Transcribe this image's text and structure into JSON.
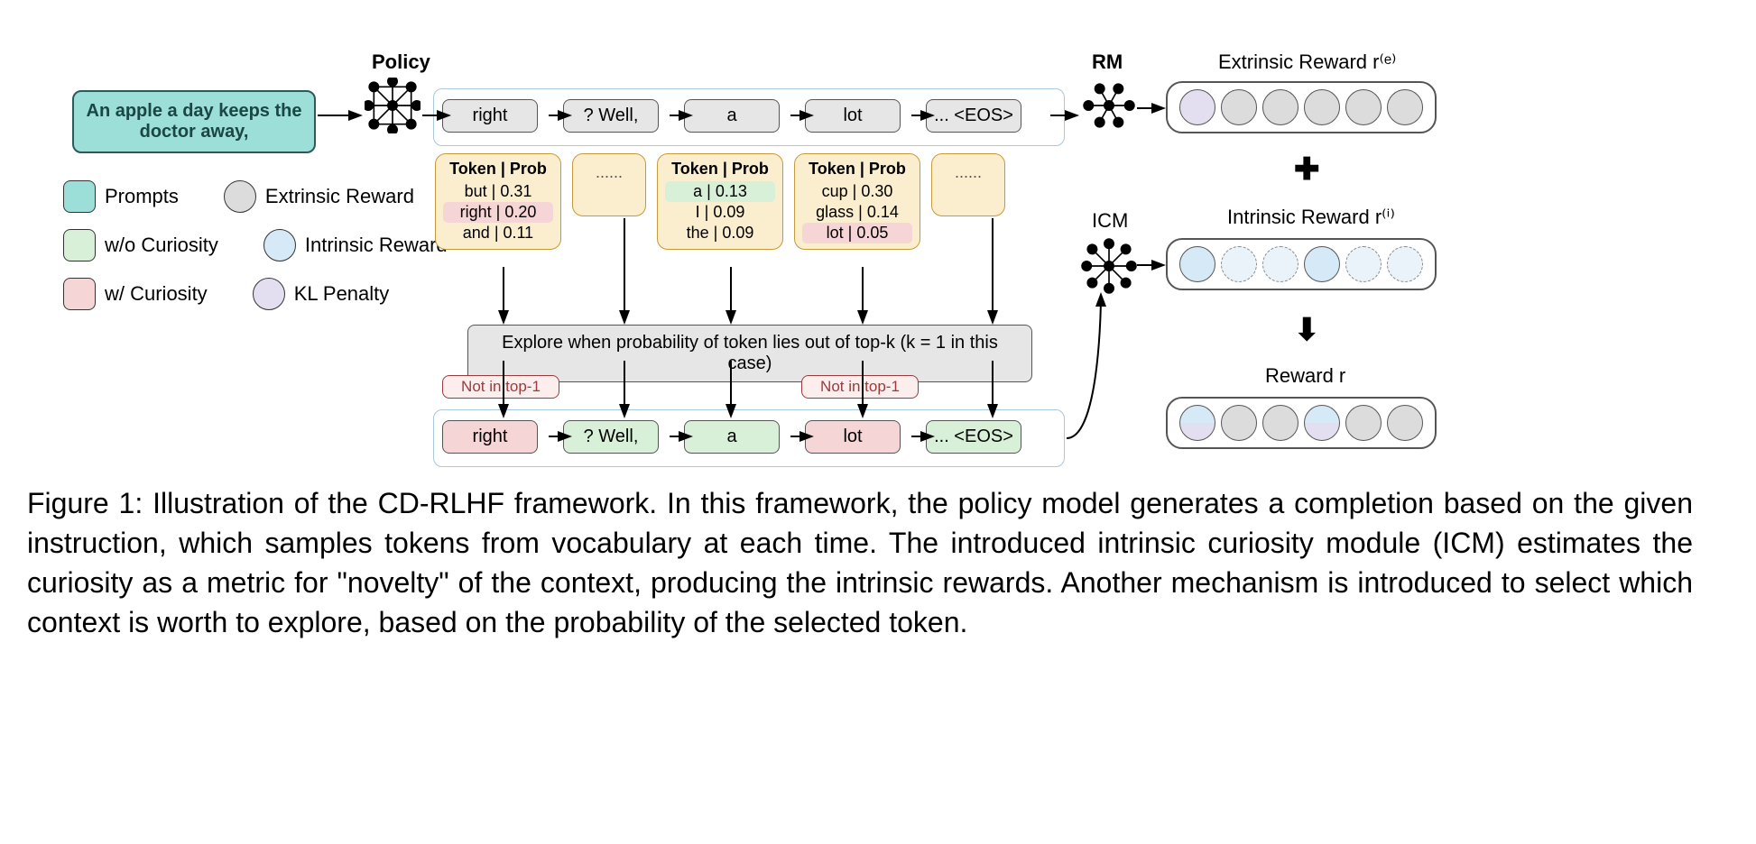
{
  "legend": {
    "prompts": "Prompts",
    "extrinsic_reward": "Extrinsic Reward",
    "wo_curiosity": "w/o Curiosity",
    "intrinsic_reward": "Intrinsic Reward",
    "w_curiosity": "w/ Curiosity",
    "kl_penalty": "KL Penalty"
  },
  "prompt": "An apple a day keeps the doctor away,",
  "labels": {
    "policy": "Policy",
    "rm": "RM",
    "icm": "ICM",
    "extrinsic_title": "Extrinsic Reward r⁽ᵉ⁾",
    "intrinsic_title": "Intrinsic Reward r⁽ⁱ⁾",
    "reward_title": "Reward r"
  },
  "tokens_top": [
    "right",
    "? Well,",
    "a",
    "lot",
    "... <EOS>"
  ],
  "prob_header": "Token | Prob",
  "prob1": [
    {
      "t": "but | 0.31",
      "cls": ""
    },
    {
      "t": "right | 0.20",
      "cls": "pink"
    },
    {
      "t": "and | 0.11",
      "cls": ""
    }
  ],
  "prob2": [
    {
      "t": "a | 0.13",
      "cls": "green"
    },
    {
      "t": "I | 0.09",
      "cls": ""
    },
    {
      "t": "the | 0.09",
      "cls": ""
    }
  ],
  "prob3": [
    {
      "t": "cup | 0.30",
      "cls": ""
    },
    {
      "t": "glass | 0.14",
      "cls": ""
    },
    {
      "t": "lot | 0.05",
      "cls": "pink"
    }
  ],
  "prob_ellipsis": "......",
  "explore": "Explore when probability of token lies out of top-k (k = 1 in this case)",
  "not_in": "Not in top-1",
  "tokens_bot": [
    "right",
    "? Well,",
    "a",
    "lot",
    "... <EOS>"
  ],
  "tokens_bot_cls": [
    "pink",
    "green",
    "green",
    "pink",
    "green"
  ],
  "caption_label": "Figure 1:",
  "caption_text": " Illustration of the CD-RLHF framework. In this framework, the policy model generates a completion based on the given instruction, which samples tokens from vocabulary at each time. The introduced intrinsic curiosity module (ICM) estimates the curiosity as a metric for \"novelty\" of the context, producing the intrinsic rewards. Another mechanism is introduced to select which context is worth to explore, based on the probability of the selected token."
}
